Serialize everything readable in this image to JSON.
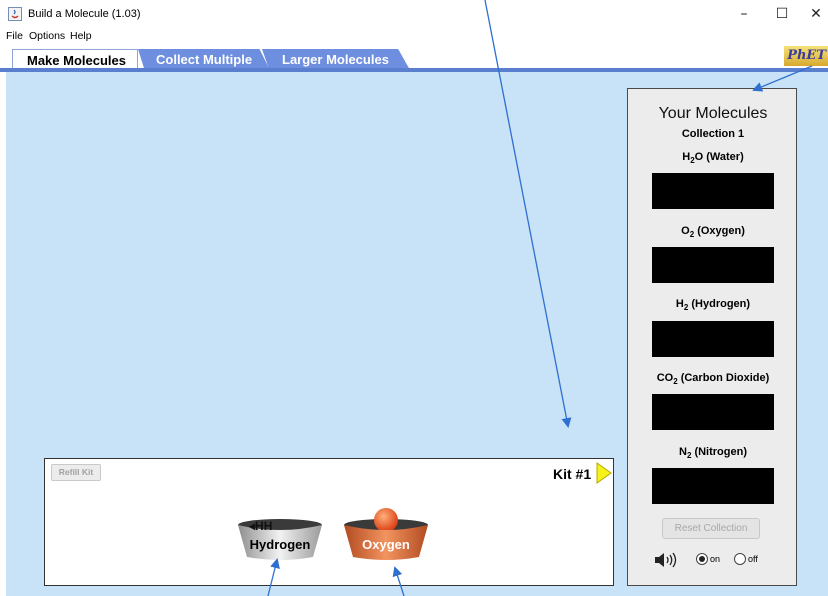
{
  "window": {
    "title": "Build a Molecule (1.03)",
    "minimize_glyph": "–",
    "maximize_glyph": "☐",
    "close_glyph": "✕"
  },
  "menu": [
    "File",
    "Options",
    "Help"
  ],
  "tabs": [
    {
      "label": "Make Molecules",
      "active": true
    },
    {
      "label": "Collect Multiple",
      "active": false
    },
    {
      "label": "Larger Molecules",
      "active": false
    }
  ],
  "logo": {
    "text": "PhET"
  },
  "kit": {
    "refill_label": "Refill Kit",
    "kit_label": "Kit #1",
    "buckets": [
      {
        "label": "Hydrogen",
        "atoms_text": "◂HH",
        "color": "#c9c9c9"
      },
      {
        "label": "Oxygen",
        "atom_symbol": "O",
        "color": "#d6673c"
      }
    ]
  },
  "collection": {
    "title": "Your Molecules",
    "subtitle": "Collection 1",
    "molecules": [
      {
        "formula": "H",
        "sub": "2",
        "rest": "O (Water)"
      },
      {
        "formula": "O",
        "sub": "2",
        "rest": " (Oxygen)"
      },
      {
        "formula": "H",
        "sub": "2",
        "rest": " (Hydrogen)"
      },
      {
        "formula": "CO",
        "sub": "2",
        "rest": " (Carbon Dioxide)"
      },
      {
        "formula": "N",
        "sub": "2",
        "rest": " (Nitrogen)"
      }
    ],
    "reset_label": "Reset Collection",
    "sound": {
      "on_label": "on",
      "off_label": "off",
      "selected": "on"
    }
  },
  "colors": {
    "play_area": "#c8e2f8",
    "tab_inactive": "#6e8ee0",
    "annotation_arrow": "#2f6fcf"
  }
}
